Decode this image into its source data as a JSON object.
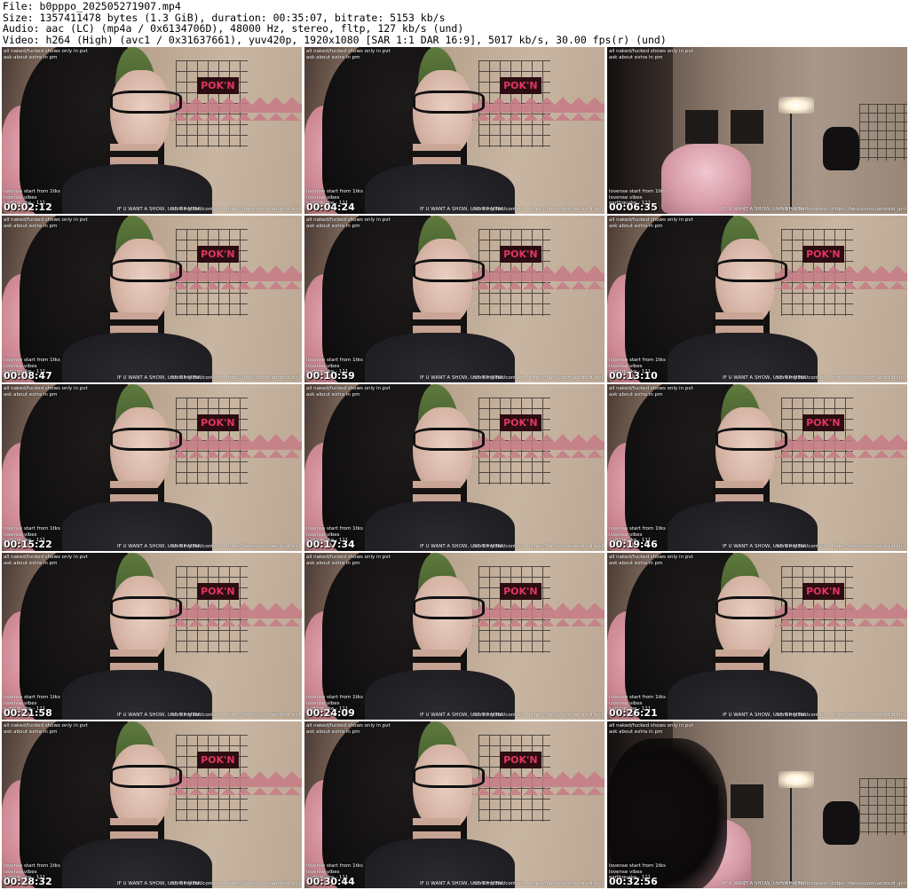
{
  "header": {
    "file_line": "File: b0pppo_202505271907.mp4",
    "size_line": "Size: 1357411478 bytes (1.3 GiB), duration: 00:35:07, bitrate: 5153 kb/s",
    "audio_line": "Audio: aac (LC) (mp4a / 0x6134706D), 48000 Hz, stereo, fltp, 127 kb/s (und)",
    "video_line": "Video: h264 (High) (avc1 / 0x31637661), yuv420p, 1920x1080 [SAR 1:1 DAR 16:9], 5017 kb/s, 30.00 fps(r) (und)"
  },
  "overlay": {
    "top_line1": "all naked/fucked shows only in pvt",
    "top_line2": "ask about extra in pm",
    "mid_line1": "lovense start from 1tks",
    "mid_line2": "lovense vibes",
    "mid_line3": "earthquake - 111",
    "bottom_center": "IF U WANT A SHOW, USE TIP MENU",
    "bottom_right": "more my hot content - https://fansly.com/android_girl",
    "sign_text": "POK'N"
  },
  "frames": [
    {
      "timestamp": "00:02:12",
      "scene": "person"
    },
    {
      "timestamp": "00:04:24",
      "scene": "person"
    },
    {
      "timestamp": "00:06:35",
      "scene": "room"
    },
    {
      "timestamp": "00:08:47",
      "scene": "person"
    },
    {
      "timestamp": "00:10:59",
      "scene": "person"
    },
    {
      "timestamp": "00:13:10",
      "scene": "person"
    },
    {
      "timestamp": "00:15:22",
      "scene": "person"
    },
    {
      "timestamp": "00:17:34",
      "scene": "person"
    },
    {
      "timestamp": "00:19:46",
      "scene": "person"
    },
    {
      "timestamp": "00:21:58",
      "scene": "person"
    },
    {
      "timestamp": "00:24:09",
      "scene": "person"
    },
    {
      "timestamp": "00:26:21",
      "scene": "person"
    },
    {
      "timestamp": "00:28:32",
      "scene": "person"
    },
    {
      "timestamp": "00:30:44",
      "scene": "person"
    },
    {
      "timestamp": "00:32:56",
      "scene": "room"
    }
  ]
}
